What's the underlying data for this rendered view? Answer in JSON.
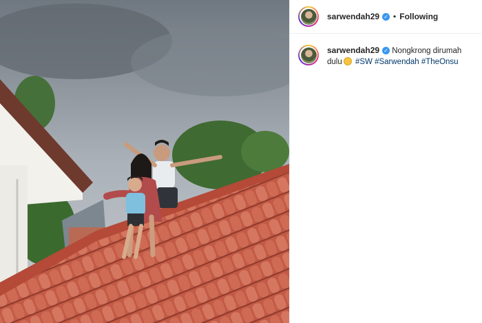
{
  "post": {
    "username": "sarwendah29",
    "follow_status": "Following",
    "separator": "•",
    "caption": {
      "text_before_emoji": "Nongkrong dirumah dulu",
      "emoji": "rolling-on-floor-laughing",
      "hashtags": [
        "#SW",
        "#Sarwendah",
        "#TheOnsu"
      ]
    }
  },
  "colors": {
    "verified": "#3897f0",
    "hashtag": "#00376b",
    "text": "#262626",
    "roof_tile": "#c9614a"
  },
  "icons": {
    "verified": "verified-badge-icon"
  }
}
